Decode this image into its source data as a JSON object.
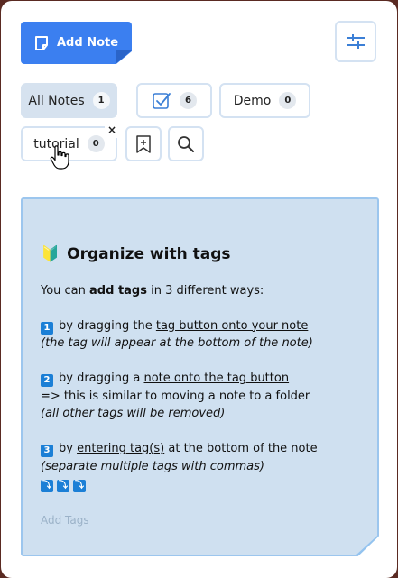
{
  "toolbar": {
    "add_note_label": "Add Note"
  },
  "tabs": [
    {
      "label": "All Notes",
      "count": "1"
    },
    {
      "label": "",
      "count": "6"
    },
    {
      "label": "Demo",
      "count": "0"
    },
    {
      "label": "tutorial",
      "count": "0",
      "close": "×"
    }
  ],
  "note": {
    "emoji": "🔰",
    "title": "Organize with tags",
    "intro_pre": "You can ",
    "intro_bold": "add tags",
    "intro_post": " in 3 different ways:",
    "way1_num": "1",
    "way1_pre": "by dragging the ",
    "way1_link": "tag button onto your note",
    "way1_note": "(the tag will appear at the bottom of the note)",
    "way2_num": "2",
    "way2_pre": "by dragging a ",
    "way2_link": "note onto the tag button",
    "way2_line2": "=> this is similar to moving a note to a folder",
    "way2_note": "(all other tags will be removed)",
    "way3_num": "3",
    "way3_pre": "by ",
    "way3_link": "entering tag(s)",
    "way3_post": " at the bottom of the note",
    "way3_note": "(separate multiple tags with commas)",
    "arrows": [
      "⤵",
      "⤵",
      "⤵"
    ],
    "add_tags_placeholder": "Add Tags"
  },
  "colors": {
    "accent": "#3b7ff0",
    "note_bg": "#cfe0f0",
    "note_border": "#9cc6ee"
  }
}
